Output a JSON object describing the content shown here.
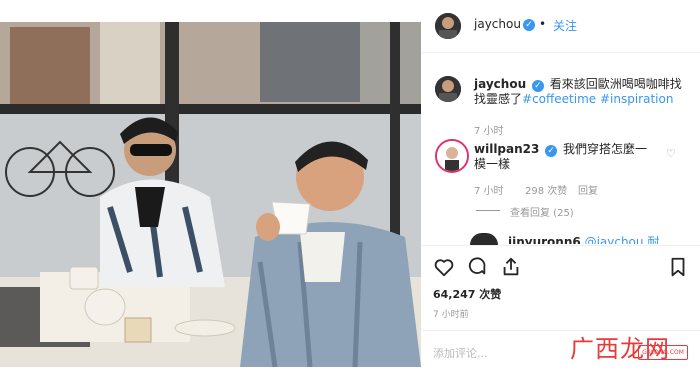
{
  "header": {
    "username": "jaychou",
    "separator": "•",
    "follow_label": "关注"
  },
  "caption": {
    "username": "jaychou",
    "text": "看來該回歐洲喝喝咖啡找找靈感了",
    "hashtags": "#coffeetime #inspiration",
    "time": "7 小时"
  },
  "comment1": {
    "username": "willpan23",
    "text": "我們穿搭怎麼一模一樣",
    "time": "7 小时",
    "likes": "298 次赞",
    "reply_label": "回复",
    "view_replies": "查看回复 (25)"
  },
  "comment2": {
    "username": "jinyuronn6",
    "text": "@jaychou 耐"
  },
  "actions": {
    "icons": [
      "heart-icon",
      "comment-icon",
      "share-icon",
      "bookmark-icon"
    ]
  },
  "stats": {
    "likes": "64,247 次赞",
    "time": "7 小时前"
  },
  "comment_input": {
    "placeholder": "添加评论..."
  },
  "watermark": {
    "text": "广西龙网",
    "logo": "GXLONG.COM"
  },
  "colors": {
    "link": "#3897f0",
    "watermark": "#e83a3a"
  }
}
